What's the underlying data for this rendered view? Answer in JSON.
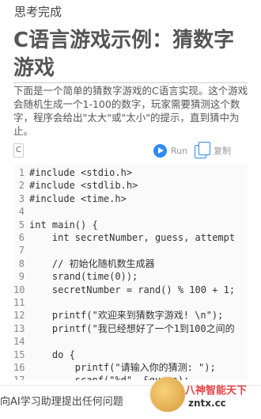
{
  "status_text": "思考完成",
  "title": "C语言游戏示例：猜数字游戏",
  "description": "下面是一个简单的猜数字游戏的C语言实现。这个游戏会随机生成一个1-100的数字，玩家需要猜测这个数字，程序会给出\"太大\"或\"太小\"的提示，直到猜中为止。",
  "toolbar": {
    "lang": "C",
    "run_label": "Run",
    "copy_label": "复制"
  },
  "code": {
    "lines": [
      {
        "n": "1",
        "text": "#include <stdio.h>"
      },
      {
        "n": "2",
        "text": "#include <stdlib.h>"
      },
      {
        "n": "3",
        "text": "#include <time.h>"
      },
      {
        "n": "4",
        "text": ""
      },
      {
        "n": "5",
        "text": "int main() {"
      },
      {
        "n": "6",
        "text": "    int secretNumber, guess, attempt"
      },
      {
        "n": "7",
        "text": ""
      },
      {
        "n": "8",
        "text": "    // 初始化随机数生成器"
      },
      {
        "n": "9",
        "text": "    srand(time(0));"
      },
      {
        "n": "10",
        "text": "    secretNumber = rand() % 100 + 1;"
      },
      {
        "n": "11",
        "text": ""
      },
      {
        "n": "12",
        "text": "    printf(\"欢迎来到猜数字游戏! \\n\");"
      },
      {
        "n": "13",
        "text": "    printf(\"我已经想好了一个1到100之间的"
      },
      {
        "n": "14",
        "text": ""
      },
      {
        "n": "15",
        "text": "    do {"
      },
      {
        "n": "16",
        "text": "        printf(\"请输入你的猜测: \");"
      },
      {
        "n": "17",
        "text": "        scanf(\"%d\", &guess);"
      }
    ]
  },
  "bottom": {
    "input_placeholder": "向AI学习助理提出任何问题"
  },
  "watermark": {
    "brand": "八神智能天下",
    "domain": "zntx.cc"
  }
}
